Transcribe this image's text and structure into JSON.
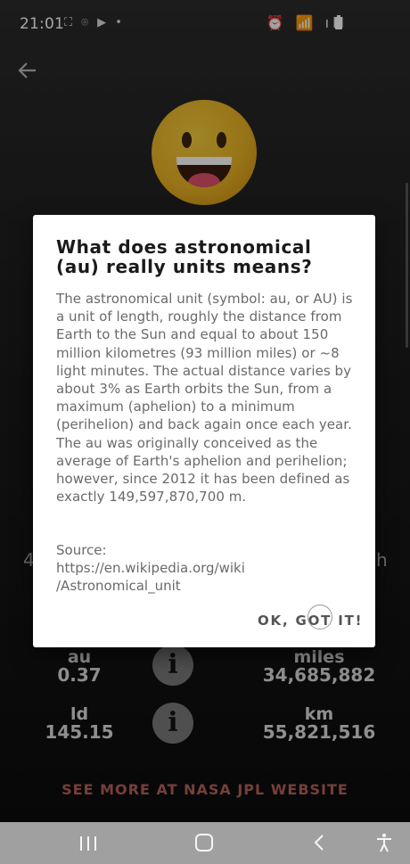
{
  "status_bar": {
    "time": "21:01",
    "left_icons": "⛶ ⌾ ▶ •",
    "right_icons": "⏰ 📶 ıll",
    "battery_icon": "battery-icon"
  },
  "screen": {
    "side_left_text": "4",
    "side_right_text": "h"
  },
  "stats": {
    "au_label": "au",
    "au_value": "0.37",
    "miles_label": "miles",
    "miles_value": "34,685,882",
    "ld_label": "ld",
    "ld_value": "145.15",
    "km_label": "km",
    "km_value": "55,821,516",
    "info_glyph": "i"
  },
  "nasa_link": "SEE MORE AT NASA JPL WEBSITE",
  "dialog": {
    "title": "What does astronomical (au) really units means?",
    "body": "The astronomical unit (symbol: au, or AU) is a unit of length, roughly the distance from Earth to the Sun and equal to about 150 million kilometres (93 million miles) or ~8 light minutes. The actual distance varies by about 3% as Earth orbits the Sun, from a maximum (aphelion) to a minimum (perihelion) and back again once each year. The au was originally conceived as the average of Earth's aphelion and perihelion; however, since 2012 it has been defined as exactly 149,597,870,700 m.",
    "source_label": "Source:",
    "source_url_line1": "https://en.wikipedia.org/wiki",
    "source_url_line2": "/Astronomical_unit",
    "ok_label": "OK, GOT IT!"
  },
  "colors": {
    "link": "#b5625a",
    "dialog_bg": "#ffffff",
    "info_button": "#7a7a7a",
    "navbar": "#a0a0a0"
  },
  "icons": [
    "back-arrow-icon",
    "smiling-emoji-icon",
    "info-icon",
    "recent-apps-icon",
    "home-icon",
    "back-icon",
    "accessibility-icon"
  ]
}
